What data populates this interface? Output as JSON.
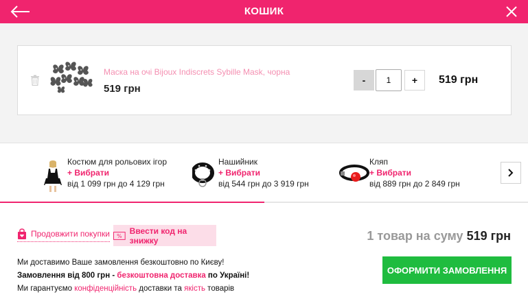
{
  "header": {
    "title": "КОШИК",
    "back_icon": "arrow-left-icon",
    "close_icon": "close-icon",
    "background": "#f0246e"
  },
  "cart": {
    "items": [
      {
        "name": "Маска на очі Bijoux Indiscrets Sybille Mask, чорна",
        "price": "519 грн",
        "quantity": "1",
        "total": "519 грн",
        "minus_label": "-",
        "plus_label": "+",
        "delete_icon": "trash-icon"
      }
    ]
  },
  "recommendations": {
    "choose_label": "+ Вибрати",
    "items": [
      {
        "title": "Костюм для рольових ігор",
        "range": "від 1 099 грн до 4 129 грн",
        "icon": "costume-thumbnail"
      },
      {
        "title": "Нашийник",
        "range": "від 544 грн до 3 919 грн",
        "icon": "collar-thumbnail"
      },
      {
        "title": "Кляп",
        "range": "від 889 грн до 2 849 грн",
        "icon": "gag-thumbnail"
      }
    ],
    "next_icon": "chevron-right-icon",
    "scroll_progress": 0.5
  },
  "footer": {
    "continue_label": "Продовжити покупки",
    "promo_label": "Ввести код на знижку",
    "summary_prefix": "1 товар на суму",
    "summary_amount": "519 грн",
    "info_line1": "Ми доставимо Ваше замовлення безкоштовно по Києву!",
    "info_line2_a": "Замовлення від 800 грн - ",
    "info_line2_b": "безкоштовна доставка",
    "info_line2_c": " по Україні!",
    "info_line3_a": "Ми гарантуємо ",
    "info_line3_b": "конфіденційність",
    "info_line3_c": " доставки та ",
    "info_line3_d": "якість",
    "info_line3_e": " товарів",
    "order_label": "ОФОРМИТИ ЗАМОВЛЕННЯ"
  },
  "colors": {
    "accent": "#f0246e",
    "order_button": "#1fbc3f"
  }
}
